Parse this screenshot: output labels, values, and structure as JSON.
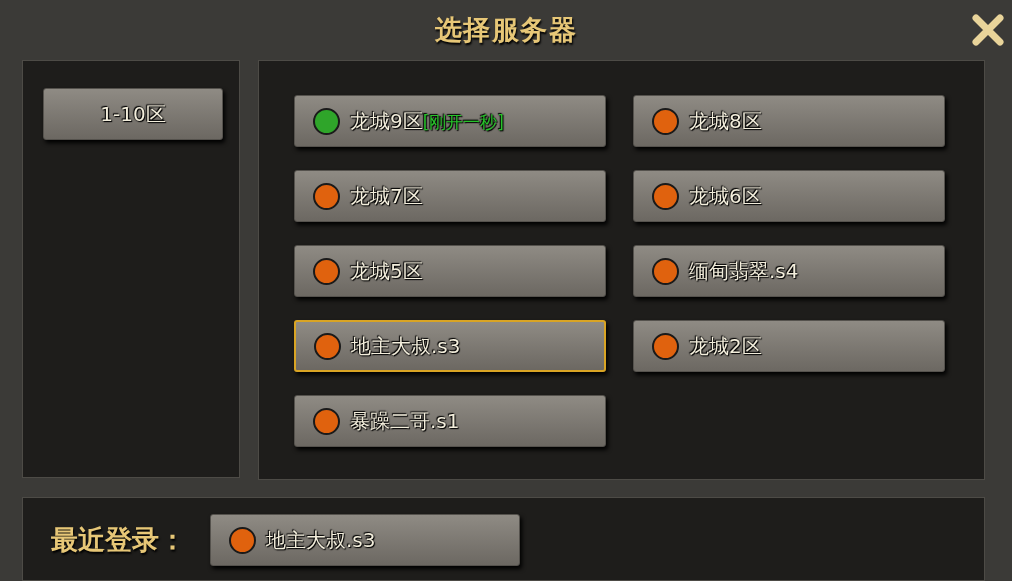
{
  "window": {
    "title": "选择服务器"
  },
  "zones": [
    {
      "label": "1-10区",
      "selected": true
    }
  ],
  "servers": [
    {
      "name": "龙城9区",
      "tag": "[刚开一秒]",
      "color": "#2fa52a",
      "selected": false
    },
    {
      "name": "龙城8区",
      "color": "#e0620e",
      "selected": false
    },
    {
      "name": "龙城7区",
      "color": "#e0620e",
      "selected": false
    },
    {
      "name": "龙城6区",
      "color": "#e0620e",
      "selected": false
    },
    {
      "name": "龙城5区",
      "color": "#e0620e",
      "selected": false
    },
    {
      "name": "缅甸翡翠.s4",
      "color": "#e0620e",
      "selected": false
    },
    {
      "name": "地主大叔.s3",
      "color": "#e0620e",
      "selected": true
    },
    {
      "name": "龙城2区",
      "color": "#e0620e",
      "selected": false
    },
    {
      "name": "暴躁二哥.s1",
      "color": "#e0620e",
      "selected": false
    }
  ],
  "recent": {
    "label": "最近登录：",
    "server": {
      "name": "地主大叔.s3",
      "color": "#e0620e"
    }
  }
}
